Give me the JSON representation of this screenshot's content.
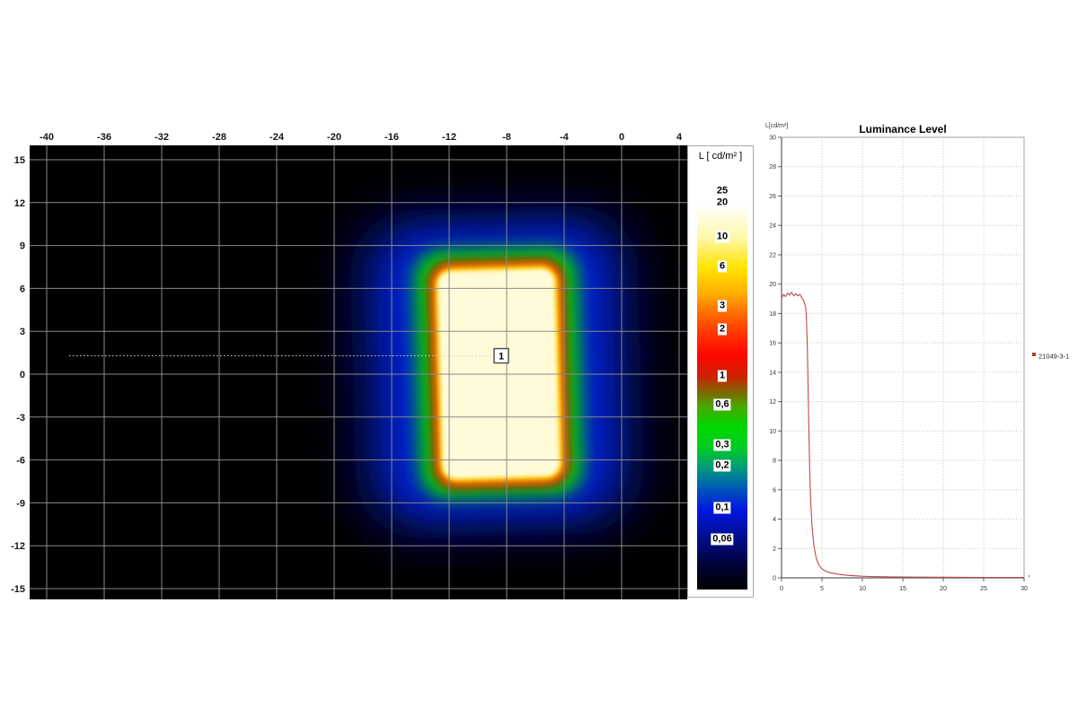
{
  "app": {
    "description_left_panel": "false-color luminance map",
    "description_right_panel": "luminance profile chart"
  },
  "chart_data": [
    {
      "type": "heatmap",
      "title": "",
      "xlabel": "",
      "ylabel": "",
      "x_ticks": [
        "-40",
        "-36",
        "-32",
        "-28",
        "-24",
        "-20",
        "-16",
        "-12",
        "-8",
        "-4",
        "0",
        "4"
      ],
      "y_ticks": [
        "15",
        "12",
        "9",
        "6",
        "3",
        "0",
        "-3",
        "-6",
        "-9",
        "-12",
        "-15"
      ],
      "x_range": [
        -41.2,
        4.6
      ],
      "y_range": [
        -15.6,
        16.0
      ],
      "grid": true,
      "background": "#000000",
      "glow_colors": [
        "#000d6b",
        "#0021cf",
        "#00cb00",
        "#e81000",
        "#ffdc00",
        "#fffbd8"
      ],
      "bright_region": {
        "label": "1",
        "x_extent_deg": [
          -12.2,
          -4.6
        ],
        "y_extent_deg": [
          -7.3,
          7.2
        ],
        "core_luminance_cdm2": 20,
        "core_color": "#fffbd8"
      },
      "measure_line": {
        "marker_label": "1",
        "marker_x_deg": -8.4,
        "marker_y_deg": 1.3,
        "line_from_deg": -38.3,
        "line_to_deg": -8.9
      },
      "colorbar": {
        "title": "L [ cd/m² ]",
        "tick_labels": [
          "25",
          "20",
          "10",
          "6",
          "3",
          "2",
          "1",
          "0,6",
          "0,3",
          "0,2",
          "0,1",
          "0,06"
        ],
        "tick_fracs": [
          0.047,
          0.075,
          0.157,
          0.227,
          0.322,
          0.378,
          0.489,
          0.558,
          0.654,
          0.704,
          0.805,
          0.88
        ],
        "gradient_stops": [
          [
            0,
            "#ffffff"
          ],
          [
            0.08,
            "#ffffff"
          ],
          [
            0.16,
            "#fff8a8"
          ],
          [
            0.23,
            "#ffe400"
          ],
          [
            0.29,
            "#ffb000"
          ],
          [
            0.33,
            "#ff7800"
          ],
          [
            0.38,
            "#ff3c00"
          ],
          [
            0.44,
            "#ff0600"
          ],
          [
            0.49,
            "#cc2200"
          ],
          [
            0.53,
            "#7a6a00"
          ],
          [
            0.56,
            "#4da400"
          ],
          [
            0.61,
            "#00d800"
          ],
          [
            0.66,
            "#00cc22"
          ],
          [
            0.71,
            "#00997d"
          ],
          [
            0.76,
            "#0055bb"
          ],
          [
            0.81,
            "#0016e0"
          ],
          [
            0.88,
            "#000d88"
          ],
          [
            0.94,
            "#000338"
          ],
          [
            1,
            "#000000"
          ]
        ]
      }
    },
    {
      "type": "line",
      "title": "Luminance Level",
      "ylabel": "L[cd/m²]",
      "xlabel": "",
      "x_unit": "°",
      "xlim": [
        0,
        30
      ],
      "ylim": [
        0,
        30
      ],
      "x_ticks": [
        0,
        5,
        10,
        15,
        20,
        25,
        30
      ],
      "y_ticks": [
        0,
        2,
        4,
        6,
        8,
        10,
        12,
        14,
        16,
        18,
        20,
        22,
        24,
        26,
        28,
        30
      ],
      "grid": true,
      "legend": {
        "position": "right",
        "entries": [
          {
            "label": "21049-3-1",
            "color": "#b23a30"
          }
        ]
      },
      "series": [
        {
          "name": "21049-3-1",
          "color": "#bf4a42",
          "x": [
            0,
            0.25,
            0.5,
            0.75,
            1,
            1.25,
            1.5,
            1.75,
            2,
            2.25,
            2.5,
            2.75,
            3,
            3.1,
            3.2,
            3.3,
            3.4,
            3.5,
            3.6,
            3.8,
            4,
            4.3,
            4.6,
            5,
            5.5,
            6,
            7,
            8,
            9,
            10,
            11,
            12,
            13.5,
            15,
            17,
            19,
            21,
            24,
            27,
            30
          ],
          "y": [
            19.05,
            19.3,
            19.15,
            19.4,
            19.25,
            19.45,
            19.2,
            19.35,
            19.2,
            19.3,
            19.1,
            18.85,
            18.4,
            17.3,
            15.5,
            12.5,
            9.5,
            7.0,
            5.2,
            3.3,
            2.2,
            1.3,
            0.9,
            0.6,
            0.45,
            0.35,
            0.25,
            0.18,
            0.14,
            0.11,
            0.09,
            0.08,
            0.07,
            0.06,
            0.05,
            0.04,
            0.04,
            0.03,
            0.03,
            0.03
          ]
        }
      ]
    }
  ]
}
